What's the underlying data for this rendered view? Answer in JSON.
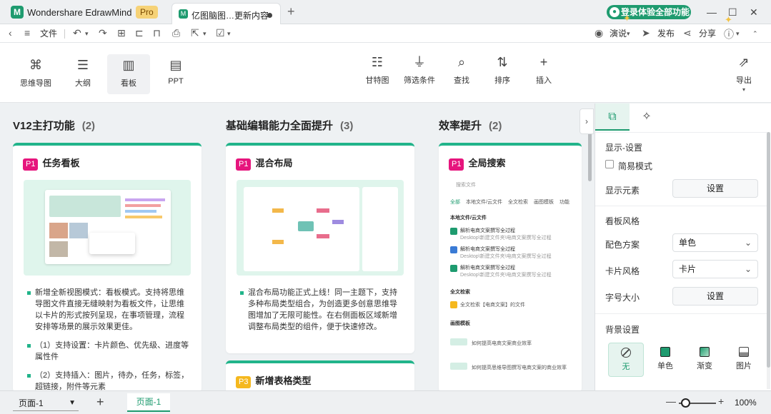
{
  "app": {
    "name": "Wondershare EdrawMind",
    "pro": "Pro"
  },
  "tab": {
    "title": "亿图脑图…更新内容"
  },
  "login": {
    "label": "登录体验全部功能"
  },
  "menu": {
    "file": "文件",
    "present": "演说",
    "publish": "发布",
    "share": "分享"
  },
  "views": [
    {
      "label": "思维导图",
      "icon": "mindmap-icon"
    },
    {
      "label": "大纲",
      "icon": "outline-icon"
    },
    {
      "label": "看板",
      "icon": "kanban-icon"
    },
    {
      "label": "PPT",
      "icon": "ppt-icon"
    }
  ],
  "ribbon_right": [
    {
      "label": "甘特图",
      "icon": "gantt-icon"
    },
    {
      "label": "筛选条件",
      "icon": "filter-icon"
    },
    {
      "label": "查找",
      "icon": "find-icon"
    },
    {
      "label": "排序",
      "icon": "sort-icon"
    },
    {
      "label": "插入",
      "icon": "plus-icon"
    }
  ],
  "export": {
    "label": "导出"
  },
  "columns": [
    {
      "title": "V12主打功能",
      "count": "(2)",
      "card": {
        "badge": "P1",
        "title": "任务看板",
        "bullets": [
          "新增全新视图模式：看板模式。支持将思维导图文件直接无缝映射为看板文件，让思维以卡片的形式按列呈现，在事项管理，流程安排等场景的展示效果更佳。",
          "（1）支持设置：卡片颜色、优先级、进度等属性件",
          "（2）支持插入：图片，待办，任务，标签，超链接，附件等元素"
        ]
      }
    },
    {
      "title": "基础编辑能力全面提升",
      "count": "(3)",
      "card": {
        "badge": "P1",
        "title": "混合布局",
        "bullets": [
          "混合布局功能正式上线！同一主题下，支持多种布局类型组合，为创造更多创意思维导图增加了无限可能性。在右侧面板区域新增调整布局类型的组件，便于快速修改。"
        ]
      },
      "card2": {
        "badge": "P3",
        "title": "新增表格类型"
      }
    },
    {
      "title": "效率提升",
      "count": "(2)",
      "card": {
        "badge": "P1",
        "title": "全局搜索",
        "search": {
          "placeholder": "搜索文件",
          "tabs": [
            "全部",
            "本地文件/云文件",
            "全文检索",
            "画图模板",
            "功能"
          ],
          "section1": "本地文件/云文件",
          "files": [
            {
              "title": "解析电商文案撰写全过程",
              "path": "Desktop\\新建文件夹\\电商文案撰写全过程"
            },
            {
              "title": "解析电商文案撰写全过程",
              "path": "Desktop\\新建文件夹\\电商文案撰写全过程"
            },
            {
              "title": "解析电商文案撰写全过程",
              "path": "Desktop\\新建文件夹\\电商文案撰写全过程"
            }
          ],
          "section2": "全文检索",
          "fulltext": "全文检索【电商文案】的文件",
          "section3": "画图模板",
          "templates": [
            "如何提高电商文案商业效率",
            "如何提高思维导图撰写电商文案的商业效率"
          ]
        }
      }
    }
  ],
  "panel": {
    "tabs": [
      "style-settings-icon",
      "ai-sparkle-icon"
    ],
    "display_settings": "显示-设置",
    "simple_mode": "简易模式",
    "display_elements": "显示元素",
    "setup_btn": "设置",
    "kanban_style": "看板风格",
    "color_scheme": "配色方案",
    "color_scheme_val": "单色",
    "card_style": "卡片风格",
    "card_style_val": "卡片",
    "font_size": "字号大小",
    "bg_settings": "背景设置",
    "bg_options": [
      {
        "label": "无",
        "icon": "none-icon"
      },
      {
        "label": "单色",
        "icon": "solid-color-icon"
      },
      {
        "label": "渐变",
        "icon": "gradient-icon"
      },
      {
        "label": "图片",
        "icon": "image-icon"
      }
    ]
  },
  "status": {
    "page_select": "页面-1",
    "page_tab": "页面-1",
    "zoom": "100%"
  },
  "colors": {
    "accent": "#1e9b6f",
    "p1": "#e6157d",
    "p3": "#f5b81e"
  }
}
